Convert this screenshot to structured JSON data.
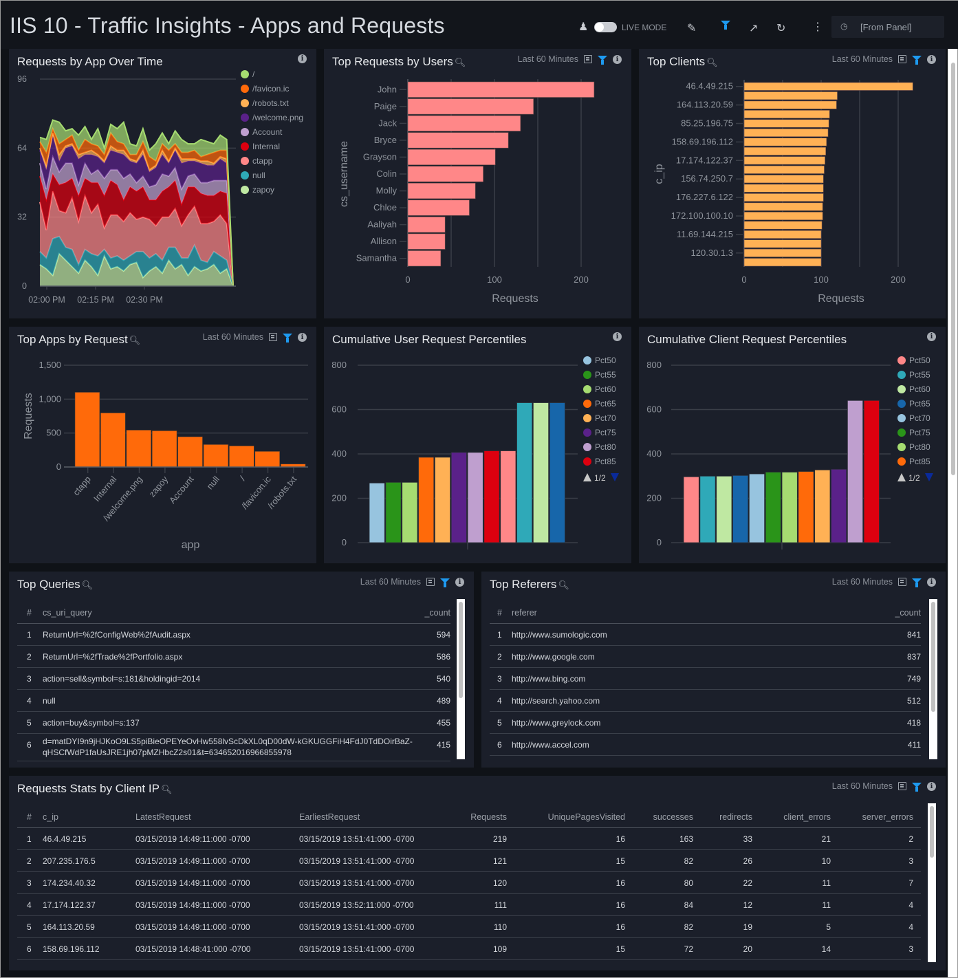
{
  "header": {
    "title": "IIS 10 - Traffic Insights - Apps and Requests",
    "live_mode_label": "LIVE MODE",
    "live_mode_on": false,
    "time_range": "[From Panel]",
    "icons": [
      "user-icon",
      "pencil-icon",
      "filter-icon",
      "share-icon",
      "refresh-icon",
      "kebab-menu-icon",
      "clock-icon"
    ]
  },
  "colors": {
    "accent": "#1e9af0",
    "panel_bg": "#1b1f2a",
    "link": "#2b8fe3"
  },
  "common": {
    "time_label": "Last 60 Minutes"
  },
  "panels": {
    "p1": {
      "title": "Requests by App Over Time"
    },
    "p2": {
      "title": "Top Requests by Users"
    },
    "p3": {
      "title": "Top Clients"
    },
    "p4": {
      "title": "Top Apps by Request"
    },
    "p5": {
      "title": "Cumulative User Request Percentiles"
    },
    "p6": {
      "title": "Cumulative Client Request Percentiles"
    },
    "p7": {
      "title": "Top Queries"
    },
    "p8": {
      "title": "Top Referers"
    },
    "p9": {
      "title": "Requests Stats by Client IP"
    }
  },
  "chart_data": [
    {
      "type": "area",
      "stacked": true,
      "ylim": [
        0,
        96
      ],
      "yticks": [
        "0",
        "32",
        "64",
        "96"
      ],
      "xticks": [
        "02:00 PM",
        "02:15 PM",
        "02:30 PM"
      ],
      "x": [
        "01:58 PM",
        "02:00 PM",
        "02:02 PM",
        "02:04 PM",
        "02:06 PM",
        "02:08 PM",
        "02:10 PM",
        "02:12 PM",
        "02:14 PM",
        "02:16 PM",
        "02:18 PM",
        "02:20 PM",
        "02:22 PM",
        "02:24 PM",
        "02:26 PM",
        "02:28 PM",
        "02:30 PM",
        "02:32 PM",
        "02:34 PM",
        "02:36 PM",
        "02:38 PM",
        "02:40 PM",
        "02:42 PM",
        "02:44 PM",
        "02:46 PM",
        "02:48 PM",
        "02:50 PM",
        "02:52 PM",
        "02:54 PM",
        "02:56 PM",
        "02:57 PM"
      ],
      "legend": "right",
      "series": [
        {
          "name": "zapoy",
          "color": "#bfe8a2",
          "values": [
            10,
            8,
            5,
            15,
            12,
            9,
            6,
            12,
            9,
            5,
            14,
            8,
            9,
            7,
            10,
            11,
            4,
            7,
            9,
            6,
            12,
            8,
            10,
            5,
            9,
            7,
            8,
            10,
            6,
            8,
            0
          ]
        },
        {
          "name": "null",
          "color": "#2fa9b8",
          "values": [
            6,
            5,
            17,
            8,
            6,
            8,
            4,
            5,
            6,
            9,
            3,
            5,
            5,
            5,
            4,
            5,
            12,
            6,
            6,
            6,
            6,
            10,
            3,
            8,
            10,
            5,
            3,
            6,
            8,
            4,
            0
          ]
        },
        {
          "name": "ctapp",
          "color": "#ff8788",
          "values": [
            23,
            13,
            22,
            12,
            16,
            24,
            20,
            25,
            19,
            24,
            10,
            20,
            19,
            18,
            20,
            15,
            16,
            18,
            13,
            20,
            14,
            18,
            15,
            20,
            18,
            17,
            18,
            14,
            19,
            17,
            0
          ]
        },
        {
          "name": "Internal",
          "color": "#dd000f",
          "values": [
            12,
            14,
            8,
            12,
            14,
            9,
            12,
            8,
            14,
            10,
            15,
            16,
            14,
            10,
            12,
            13,
            14,
            9,
            12,
            12,
            14,
            13,
            10,
            13,
            9,
            14,
            13,
            12,
            11,
            14,
            0
          ]
        },
        {
          "name": "Account",
          "color": "#bf9fcf",
          "values": [
            6,
            5,
            8,
            6,
            9,
            7,
            5,
            7,
            4,
            6,
            8,
            5,
            7,
            10,
            6,
            4,
            5,
            6,
            7,
            8,
            5,
            6,
            7,
            5,
            6,
            5,
            6,
            7,
            5,
            6,
            0
          ]
        },
        {
          "name": "/welcome.png",
          "color": "#5a2189",
          "values": [
            6,
            9,
            10,
            5,
            7,
            8,
            12,
            4,
            9,
            6,
            7,
            9,
            8,
            11,
            6,
            9,
            10,
            7,
            8,
            9,
            6,
            8,
            12,
            7,
            6,
            9,
            8,
            7,
            10,
            8,
            0
          ]
        },
        {
          "name": "/robots.txt",
          "color": "#ffb155",
          "values": [
            1,
            2,
            1,
            3,
            1,
            1,
            2,
            1,
            2,
            1,
            1,
            2,
            1,
            2,
            1,
            1,
            2,
            1,
            1,
            2,
            1,
            1,
            2,
            1,
            1,
            1,
            2,
            1,
            1,
            2,
            0
          ]
        },
        {
          "name": "/favicon.ic",
          "color": "#ff6a0a",
          "values": [
            3,
            6,
            2,
            5,
            3,
            4,
            2,
            6,
            3,
            4,
            3,
            6,
            4,
            3,
            2,
            3,
            4,
            6,
            2,
            3,
            5,
            2,
            3,
            3,
            4,
            2,
            3,
            5,
            3,
            4,
            0
          ]
        },
        {
          "name": "/",
          "color": "#a6dc71",
          "values": [
            2,
            6,
            4,
            10,
            4,
            3,
            7,
            6,
            2,
            8,
            3,
            4,
            6,
            10,
            5,
            4,
            6,
            3,
            8,
            5,
            3,
            6,
            6,
            4,
            3,
            8,
            6,
            4,
            7,
            5,
            0
          ]
        }
      ],
      "legend_order": [
        "/",
        "/favicon.ic",
        "/robots.txt",
        "/welcome.png",
        "Account",
        "Internal",
        "ctapp",
        "null",
        "zapoy"
      ]
    },
    {
      "type": "bar",
      "orientation": "horizontal",
      "xlabel": "Requests",
      "ylabel": "cs_username",
      "xlim": [
        0,
        250
      ],
      "xticks": [
        "0",
        "100",
        "200"
      ],
      "color": "#ff8788",
      "categories": [
        "John",
        "Paige",
        "Jack",
        "Bryce",
        "Grayson",
        "Colin",
        "Molly",
        "Chloe",
        "Aaliyah",
        "Allison",
        "Samantha"
      ],
      "values": [
        215,
        145,
        130,
        116,
        101,
        87,
        78,
        71,
        43,
        43,
        38
      ]
    },
    {
      "type": "bar",
      "orientation": "horizontal",
      "xlabel": "Requests",
      "ylabel": "c_ip",
      "xlim": [
        0,
        240
      ],
      "xticks": [
        "0",
        "100",
        "200"
      ],
      "color": "#ffb155",
      "tick_labels": [
        "46.4.49.215",
        "",
        "164.113.20.59",
        "",
        "85.25.196.75",
        "",
        "158.69.196.112",
        "",
        "17.174.122.37",
        "",
        "156.74.250.7",
        "",
        "176.227.6.122",
        "",
        "172.100.100.10",
        "",
        "11.69.144.215",
        "",
        "120.30.1.3",
        ""
      ],
      "values": [
        219,
        121,
        120,
        111,
        110,
        109,
        107,
        106,
        105,
        104,
        103,
        103,
        103,
        102,
        102,
        101,
        100,
        100,
        100,
        100
      ]
    },
    {
      "type": "bar",
      "xlabel": "app",
      "ylabel": "Requests",
      "ylim": [
        0,
        1500
      ],
      "yticks": [
        "0",
        "500",
        "1,000",
        "1,500"
      ],
      "color": "#ff6a0a",
      "categories": [
        "ctapp",
        "Internal",
        "/welcome.png",
        "zapoy",
        "Account",
        "null",
        "/",
        "/favicon.ic",
        "/robots.txt"
      ],
      "values": [
        1101,
        797,
        544,
        534,
        446,
        331,
        311,
        230,
        44
      ]
    },
    {
      "type": "bar",
      "ylim": [
        0,
        800
      ],
      "yticks": [
        "0",
        "200",
        "400",
        "600",
        "800"
      ],
      "legend": "right",
      "legend_page": "1/2",
      "series": [
        {
          "name": "Pct50",
          "color": "#97c4df",
          "value": 269
        },
        {
          "name": "Pct55",
          "color": "#2a9419",
          "value": 272
        },
        {
          "name": "Pct60",
          "color": "#a6dc71",
          "value": 272
        },
        {
          "name": "Pct65",
          "color": "#ff6a0a",
          "value": 385
        },
        {
          "name": "Pct70",
          "color": "#ffb155",
          "value": 385
        },
        {
          "name": "Pct75",
          "color": "#5a2189",
          "value": 407
        },
        {
          "name": "Pct80",
          "color": "#bf9fcf",
          "value": 407
        },
        {
          "name": "Pct85",
          "color": "#dd000f",
          "value": 414
        },
        {
          "color": "#ff8788",
          "value": 414
        },
        {
          "color": "#2fa9b8",
          "value": 631
        },
        {
          "color": "#bfe8a2",
          "value": 631
        },
        {
          "color": "#1766aa",
          "value": 631
        }
      ]
    },
    {
      "type": "bar",
      "ylim": [
        0,
        800
      ],
      "yticks": [
        "0",
        "200",
        "400",
        "600",
        "800"
      ],
      "legend": "right",
      "legend_page": "1/2",
      "series": [
        {
          "name": "Pct50",
          "color": "#ff8788",
          "value": 297
        },
        {
          "name": "Pct55",
          "color": "#2fa9b8",
          "value": 300
        },
        {
          "name": "Pct60",
          "color": "#bfe8a2",
          "value": 300
        },
        {
          "name": "Pct65",
          "color": "#1766aa",
          "value": 303
        },
        {
          "name": "Pct70",
          "color": "#97c4df",
          "value": 310
        },
        {
          "name": "Pct75",
          "color": "#2a9419",
          "value": 318
        },
        {
          "name": "Pct80",
          "color": "#a6dc71",
          "value": 318
        },
        {
          "name": "Pct85",
          "color": "#ff6a0a",
          "value": 321
        },
        {
          "color": "#ffb155",
          "value": 328
        },
        {
          "color": "#5a2189",
          "value": 331
        },
        {
          "color": "#bf9fcf",
          "value": 641
        },
        {
          "color": "#dd000f",
          "value": 641
        }
      ]
    }
  ],
  "queries": {
    "columns": [
      "#",
      "cs_uri_query",
      "_count"
    ],
    "rows": [
      [
        "1",
        "ReturnUrl=%2fConfigWeb%2fAudit.aspx",
        "594"
      ],
      [
        "2",
        "ReturnUrl=%2fTrade%2fPortfolio.aspx",
        "586"
      ],
      [
        "3",
        "action=sell&symbol=s:181&holdingid=2014",
        "540"
      ],
      [
        "4",
        "null",
        "489"
      ],
      [
        "5",
        "action=buy&symbol=s:137",
        "455"
      ],
      [
        "6",
        "d=matDYI9n9jHJKoO9LS5piBieOPEYeOvHw558lvScDkXL0qD00dW-kGKUGGFiH4FdJ0TdDOirBaZ-qHSCfWdP1faUsJRE1jh07pMZHbcZ2s01&t=634652016966855978",
        "415"
      ]
    ]
  },
  "referers": {
    "columns": [
      "#",
      "referer",
      "_count"
    ],
    "rows": [
      [
        "1",
        "http://www.sumologic.com",
        "841"
      ],
      [
        "2",
        "http://www.google.com",
        "837"
      ],
      [
        "3",
        "http://www.bing.com",
        "749"
      ],
      [
        "4",
        "http://search.yahoo.com",
        "512"
      ],
      [
        "5",
        "http://www.greylock.com",
        "418"
      ],
      [
        "6",
        "http://www.accel.com",
        "411"
      ]
    ]
  },
  "stats": {
    "columns": [
      "#",
      "c_ip",
      "LatestRequest",
      "EarliestRequest",
      "Requests",
      "UniquePagesVisited",
      "successes",
      "redirects",
      "client_errors",
      "server_errors"
    ],
    "rows": [
      [
        "1",
        "46.4.49.215",
        "03/15/2019 14:49:11:000 -0700",
        "03/15/2019 13:51:41:000 -0700",
        "219",
        "16",
        "163",
        "33",
        "21",
        "2"
      ],
      [
        "2",
        "207.235.176.5",
        "03/15/2019 14:49:11:000 -0700",
        "03/15/2019 13:51:41:000 -0700",
        "121",
        "15",
        "82",
        "26",
        "10",
        "3"
      ],
      [
        "3",
        "174.234.40.32",
        "03/15/2019 14:49:11:000 -0700",
        "03/15/2019 13:51:41:000 -0700",
        "120",
        "16",
        "80",
        "22",
        "11",
        "7"
      ],
      [
        "4",
        "17.174.122.37",
        "03/15/2019 14:49:11:000 -0700",
        "03/15/2019 13:52:11:000 -0700",
        "111",
        "16",
        "84",
        "12",
        "11",
        "4"
      ],
      [
        "5",
        "164.113.20.59",
        "03/15/2019 14:49:11:000 -0700",
        "03/15/2019 13:51:41:000 -0700",
        "110",
        "16",
        "82",
        "19",
        "5",
        "4"
      ],
      [
        "6",
        "158.69.196.112",
        "03/15/2019 14:48:41:000 -0700",
        "03/15/2019 13:51:41:000 -0700",
        "109",
        "15",
        "72",
        "20",
        "14",
        "3"
      ]
    ]
  }
}
